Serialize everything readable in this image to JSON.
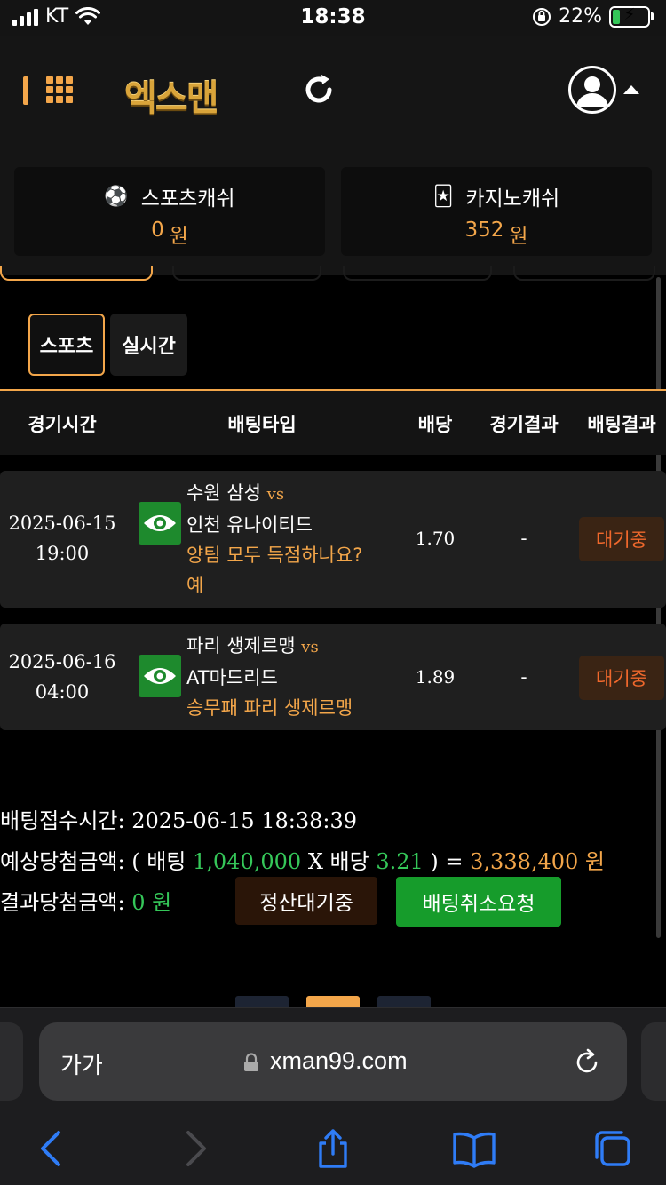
{
  "status_bar": {
    "carrier": "KT",
    "time": "18:38",
    "battery_percent": "22%",
    "battery_level": 0.22
  },
  "header": {
    "logo_text": "엑스맨"
  },
  "wallets": [
    {
      "label": "스포츠캐쉬",
      "amount": "0",
      "unit": "원",
      "icon": "soccer-ball-icon"
    },
    {
      "label": "카지노캐쉬",
      "amount": "352",
      "unit": "원",
      "icon": "casino-cards-icon"
    }
  ],
  "subtabs": [
    {
      "label": "스포츠",
      "active": true
    },
    {
      "label": "실시간",
      "active": false
    }
  ],
  "table": {
    "headers": [
      "경기시간",
      "배팅타입",
      "배당",
      "경기결과",
      "배팅결과"
    ],
    "rows": [
      {
        "date": "2025-06-15",
        "time": "19:00",
        "home": "수원 삼성",
        "vs": "vs",
        "away": "인천 유나이티드",
        "market": "양팀 모두 득점하나요?",
        "pick": "예",
        "odds": "1.70",
        "game_result": "-",
        "bet_result": "대기중"
      },
      {
        "date": "2025-06-16",
        "time": "04:00",
        "home": "파리 생제르맹",
        "vs": "vs",
        "away": "AT마드리드",
        "market": "승무패 파리 생제르맹",
        "pick": "",
        "odds": "1.89",
        "game_result": "-",
        "bet_result": "대기중"
      }
    ]
  },
  "summary": {
    "accept_time_label": "배팅접수시간:",
    "accept_time": "2025-06-15 18:38:39",
    "expected_label": "예상당첨금액:",
    "open_paren": "( 배팅",
    "bet_amount": "1,040,000",
    "times": "X 배당",
    "total_odds": "3.21",
    "close_paren": ") =",
    "expected_amount": "3,338,400 원",
    "result_label": "결과당첨금액:",
    "result_amount": "0 원",
    "settle_button": "정산대기중",
    "cancel_button": "배팅취소요청"
  },
  "browser": {
    "aa_label": "가가",
    "url": "xman99.com"
  },
  "colors": {
    "accent": "#f3a64a",
    "green": "#35c759",
    "button_green": "#169c2b",
    "pending_text": "#f0682c"
  }
}
